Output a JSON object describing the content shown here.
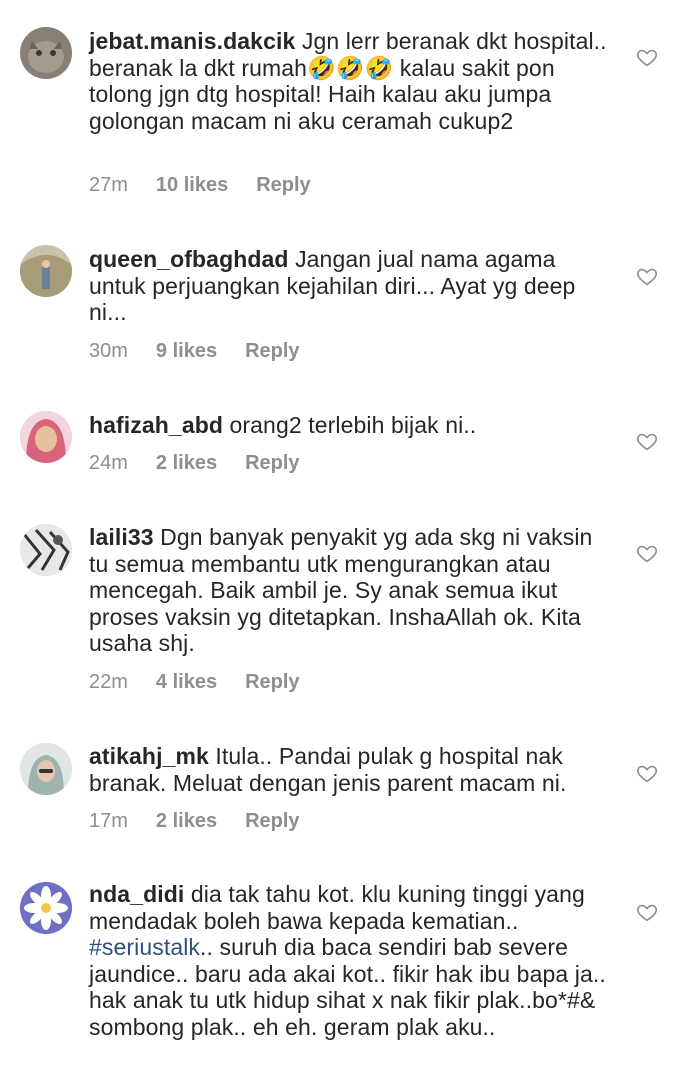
{
  "comments": [
    {
      "username": "jebat.manis.dakcik",
      "text_parts": [
        "Jgn lerr beranak dkt hospital.. beranak la dkt rumah",
        "🤣🤣🤣",
        " kalau sakit pon tolong jgn dtg hospital! Haih kalau aku jumpa golongan macam ni aku ceramah cukup2"
      ],
      "time": "27m",
      "likes": "10 likes",
      "reply": "Reply",
      "avatar_color": "#8a7f74"
    },
    {
      "username": "queen_ofbaghdad",
      "text_parts": [
        "Jangan jual nama agama untuk perjuangkan kejahilan diri... Ayat yg deep ni..."
      ],
      "time": "30m",
      "likes": "9 likes",
      "reply": "Reply",
      "avatar_color": "#b8ad8e"
    },
    {
      "username": "hafizah_abd",
      "text_parts": [
        "orang2 terlebih bijak ni.."
      ],
      "time": "24m",
      "likes": "2 likes",
      "reply": "Reply",
      "avatar_color": "#d9637b"
    },
    {
      "username": "laili33",
      "text_parts": [
        "Dgn banyak penyakit yg ada skg ni vaksin tu semua membantu utk mengurangkan atau mencegah. Baik ambil je. Sy anak semua ikut proses vaksin yg ditetapkan. InshaAllah ok. Kita usaha shj."
      ],
      "time": "22m",
      "likes": "4 likes",
      "reply": "Reply",
      "avatar_color": "#555555"
    },
    {
      "username": "atikahj_mk",
      "text_parts": [
        "Itula.. Pandai pulak g hospital nak branak. Meluat dengan jenis parent macam ni."
      ],
      "time": "17m",
      "likes": "2 likes",
      "reply": "Reply",
      "avatar_color": "#9fb3b0"
    },
    {
      "username": "nda_didi",
      "text_before_tag": "dia tak tahu kot.  klu kuning tinggi yang mendadak boleh bawa kepada kematian.. ",
      "tag": "#seriustalk",
      "text_after_tag": ".. suruh dia baca sendiri bab severe jaundice.. baru ada akai kot.. fikir hak ibu bapa ja.. hak anak tu utk hidup sihat x nak fikir plak..bo*#& sombong plak.. eh eh. geram plak aku..",
      "avatar_color": "#8f8fd8"
    }
  ],
  "icons": {
    "like": "heart-outline-icon"
  }
}
